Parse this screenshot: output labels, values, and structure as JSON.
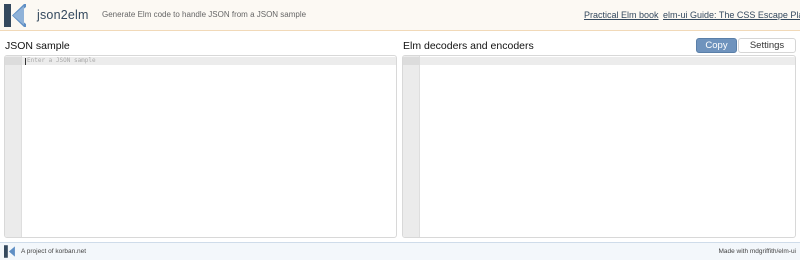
{
  "header": {
    "logo_icon": "elm-k-logo-icon",
    "app_title": "json2elm",
    "tagline": "Generate Elm code to handle JSON from a JSON sample",
    "links": {
      "book": "Practical Elm book",
      "guide": "elm-ui Guide: The CSS Escape Plan"
    }
  },
  "left_panel": {
    "title": "JSON sample",
    "placeholder": "Enter a JSON sample"
  },
  "right_panel": {
    "title": "Elm decoders and encoders",
    "copy_label": "Copy",
    "settings_label": "Settings"
  },
  "footer": {
    "left_text": "A project of korban.net",
    "right_text": "Made with mdgriffith/elm-ui"
  },
  "colors": {
    "accent": "#6f93bd",
    "header_bg": "#fcf9f3",
    "footer_bg": "#f3f7fb",
    "logo_dark": "#34495e",
    "logo_light": "#5f8fc4"
  }
}
